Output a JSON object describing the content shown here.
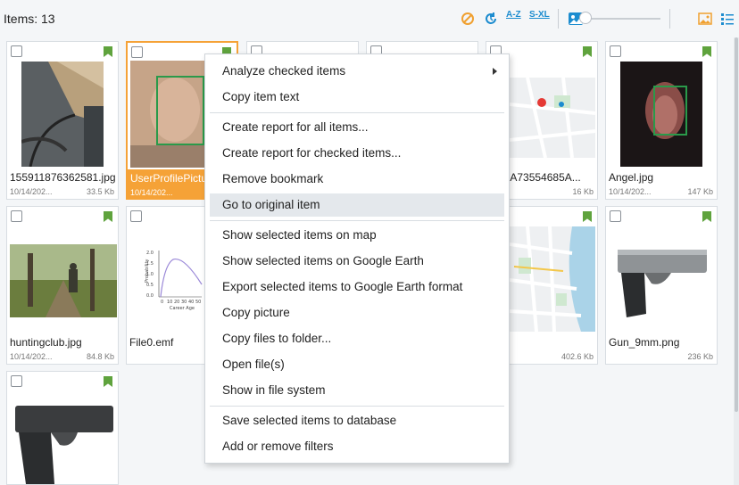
{
  "toolbar": {
    "items_count": "Items: 13",
    "sort_az": "A-Z",
    "sort_sxl": "S-XL"
  },
  "tiles": [
    {
      "name": "155911876362581.jpg",
      "date": "10/14/202...",
      "size": "33.5 Kb"
    },
    {
      "name": "UserProfilePictu",
      "date": "10/14/202...",
      "size": ""
    },
    {
      "name": "",
      "date": "",
      "size": ""
    },
    {
      "name": "",
      "date": "",
      "size": ""
    },
    {
      "name": "D5EA73554685A...",
      "date": "",
      "size": "16 Kb"
    },
    {
      "name": "Angel.jpg",
      "date": "10/14/202...",
      "size": "147 Kb"
    },
    {
      "name": "huntingclub.jpg",
      "date": "10/14/202...",
      "size": "84.8 Kb"
    },
    {
      "name": "File0.emf",
      "date": "",
      "size": ""
    },
    {
      "name": ".png",
      "date": "",
      "size": "402.6 Kb"
    },
    {
      "name": "Gun_9mm.png",
      "date": "",
      "size": "236 Kb"
    }
  ],
  "chart_thumb": {
    "ylabel": "Probability",
    "xlabel": "Career Age",
    "yticks": [
      "2.0",
      "1.5",
      "1.0",
      "0.5",
      "0.0"
    ],
    "xticks": [
      "0",
      "10",
      "20",
      "30",
      "40",
      "50"
    ]
  },
  "menu": {
    "items": [
      "Analyze checked items",
      "Copy item text",
      "Create report for all items...",
      "Create report for checked items...",
      "Remove bookmark",
      "Go to original item",
      "Show selected items on map",
      "Show selected items on Google Earth",
      "Export selected items to Google Earth format",
      "Copy picture",
      "Copy files to folder...",
      "Open file(s)",
      "Show in file system",
      "Save selected items to database",
      "Add or remove filters"
    ]
  },
  "colors": {
    "accent": "#f5a237",
    "bookmark": "#5fa33d",
    "toolbar_blue": "#1c8ccf"
  }
}
